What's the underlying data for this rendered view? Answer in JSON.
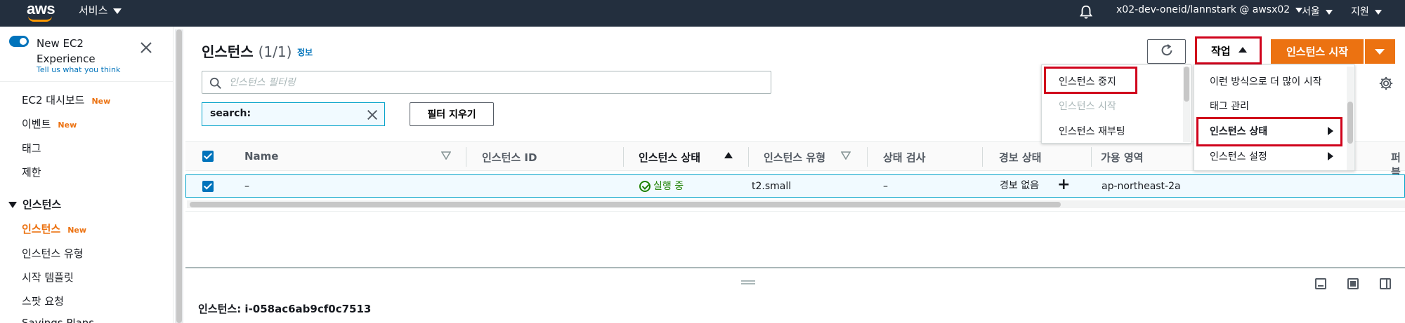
{
  "topnav": {
    "logo": "aws",
    "services": "서비스",
    "account": "x02-dev-oneid/lannstark @ awsx02",
    "region": "서울",
    "support": "지원"
  },
  "sidebar": {
    "experience_title": "New EC2 Experience",
    "feedback_link": "Tell us what you think",
    "items": [
      {
        "label": "EC2 대시보드",
        "badge": "New"
      },
      {
        "label": "이벤트",
        "badge": "New"
      },
      {
        "label": "태그",
        "badge": ""
      },
      {
        "label": "제한",
        "badge": ""
      }
    ],
    "section": "인스턴스",
    "section_items": [
      {
        "label": "인스턴스",
        "badge": "New",
        "active": true
      },
      {
        "label": "인스턴스 유형",
        "badge": ""
      },
      {
        "label": "시작 템플릿",
        "badge": ""
      },
      {
        "label": "스팟 요청",
        "badge": ""
      },
      {
        "label": "Savings Plans",
        "badge": ""
      }
    ]
  },
  "header": {
    "title": "인스턴스",
    "count": "(1/1)",
    "info": "정보"
  },
  "toolbar": {
    "actions_label": "작업",
    "launch_label": "인스턴스 시작"
  },
  "filter": {
    "placeholder": "인스턴스 필터링",
    "token": "search:",
    "clear_label": "필터 지우기"
  },
  "state_menu": {
    "items": [
      {
        "label": "인스턴스 중지",
        "disabled": false
      },
      {
        "label": "인스턴스 시작",
        "disabled": true
      },
      {
        "label": "인스턴스 재부팅",
        "disabled": false
      }
    ]
  },
  "actions_menu": {
    "items": [
      {
        "label": "이런 방식으로 더 많이 시작"
      },
      {
        "label": "태그 관리"
      },
      {
        "label": "인스턴스 상태"
      },
      {
        "label": "인스턴스 설정"
      }
    ]
  },
  "table": {
    "columns": [
      "Name",
      "인스턴스 ID",
      "인스턴스 상태",
      "인스턴스 유형",
      "상태 검사",
      "경보 상태",
      "가용 영역",
      "퍼블"
    ],
    "rows": [
      {
        "name": "–",
        "instance_id": "",
        "state": "실행 중",
        "type": "t2.small",
        "status_check": "–",
        "alarm": "경보 없음",
        "az": "ap-northeast-2a"
      }
    ]
  },
  "detail": {
    "title": "인스턴스: i-058ac6ab9cf0c7513"
  }
}
